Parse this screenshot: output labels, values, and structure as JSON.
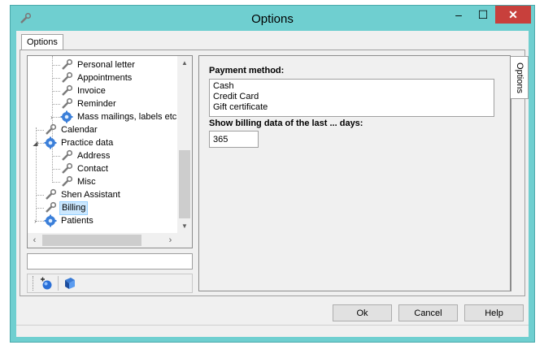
{
  "window": {
    "title": "Options",
    "title_buttons": {
      "minimize": "–",
      "maximize": "☐",
      "close": "✕"
    }
  },
  "tabs": {
    "options_label": "Options"
  },
  "tree": {
    "items": [
      {
        "label": "Personal letter",
        "icon": "tool-icon"
      },
      {
        "label": "Appointments",
        "icon": "tool-icon"
      },
      {
        "label": "Invoice",
        "icon": "tool-icon"
      },
      {
        "label": "Reminder",
        "icon": "tool-icon"
      },
      {
        "label": "Mass mailings, labels etc.",
        "icon": "gear-icon"
      },
      {
        "label": "Calendar",
        "icon": "tool-icon"
      },
      {
        "label": "Practice data",
        "icon": "gear-icon"
      },
      {
        "label": "Address",
        "icon": "tool-icon"
      },
      {
        "label": "Contact",
        "icon": "tool-icon"
      },
      {
        "label": "Misc",
        "icon": "tool-icon"
      },
      {
        "label": "Shen Assistant",
        "icon": "tool-icon"
      },
      {
        "label": "Billing",
        "icon": "tool-icon",
        "selected": true
      },
      {
        "label": "Patients",
        "icon": "gear-icon"
      }
    ]
  },
  "settings": {
    "payment_label": "Payment method:",
    "payment_options": [
      "Cash",
      "Credit Card",
      "Gift certificate"
    ],
    "days_label": "Show billing data of the last ... days:",
    "days_value": "365",
    "side_tab_label": "Options"
  },
  "buttons": {
    "ok": "Ok",
    "cancel": "Cancel",
    "help": "Help"
  },
  "colors": {
    "frame": "#6fcfd0",
    "selection": "#cce8ff",
    "close": "#c8403c"
  }
}
